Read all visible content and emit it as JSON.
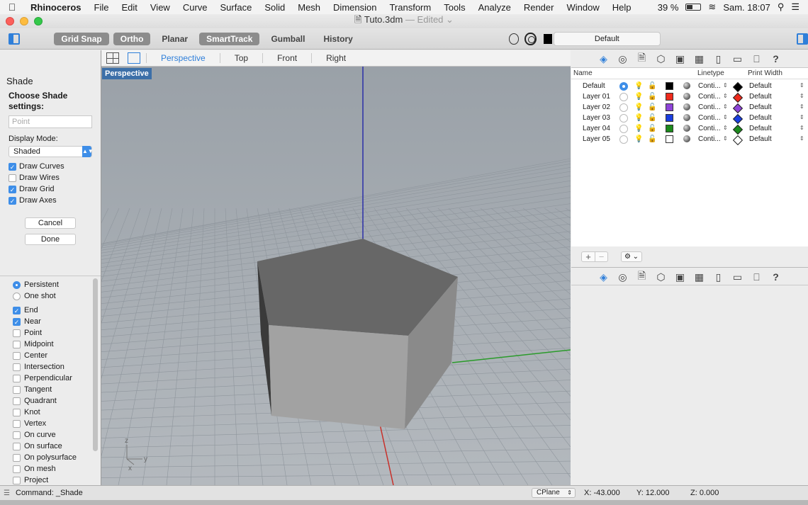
{
  "menubar": {
    "app_name": "Rhinoceros",
    "items": [
      "File",
      "Edit",
      "View",
      "Curve",
      "Surface",
      "Solid",
      "Mesh",
      "Dimension",
      "Transform",
      "Tools",
      "Analyze",
      "Render",
      "Window",
      "Help"
    ],
    "battery": "39 %",
    "clock": "Sam. 18:07"
  },
  "window": {
    "title": "Tuto.3dm",
    "edited": "— Edited"
  },
  "toolbar": {
    "grid_snap": "Grid Snap",
    "ortho": "Ortho",
    "planar": "Planar",
    "smarttrack": "SmartTrack",
    "gumball": "Gumball",
    "history": "History",
    "current_layer": "Default"
  },
  "shade_panel": {
    "title": "Shade",
    "heading": "Choose Shade settings:",
    "point_placeholder": "Point",
    "display_mode_label": "Display Mode:",
    "display_mode_value": "Shaded",
    "options": [
      {
        "label": "Draw Curves",
        "checked": true
      },
      {
        "label": "Draw Wires",
        "checked": false
      },
      {
        "label": "Draw Grid",
        "checked": true
      },
      {
        "label": "Draw Axes",
        "checked": true
      }
    ],
    "cancel": "Cancel",
    "done": "Done"
  },
  "osnap": {
    "modes": [
      {
        "label": "Persistent",
        "selected": true
      },
      {
        "label": "One shot",
        "selected": false
      }
    ],
    "snaps": [
      {
        "label": "End",
        "checked": true
      },
      {
        "label": "Near",
        "checked": true
      },
      {
        "label": "Point",
        "checked": false
      },
      {
        "label": "Midpoint",
        "checked": false
      },
      {
        "label": "Center",
        "checked": false
      },
      {
        "label": "Intersection",
        "checked": false
      },
      {
        "label": "Perpendicular",
        "checked": false
      },
      {
        "label": "Tangent",
        "checked": false
      },
      {
        "label": "Quadrant",
        "checked": false
      },
      {
        "label": "Knot",
        "checked": false
      },
      {
        "label": "Vertex",
        "checked": false
      },
      {
        "label": "On curve",
        "checked": false
      },
      {
        "label": "On surface",
        "checked": false
      },
      {
        "label": "On polysurface",
        "checked": false
      },
      {
        "label": "On mesh",
        "checked": false
      },
      {
        "label": "Project",
        "checked": false
      }
    ]
  },
  "viewport": {
    "tabs": [
      "Perspective",
      "Top",
      "Front",
      "Right"
    ],
    "active_tab": "Perspective",
    "label": "Perspective",
    "axis_labels": {
      "z": "z",
      "y": "y",
      "x": "x"
    }
  },
  "layers": {
    "headers": {
      "name": "Name",
      "linetype": "Linetype",
      "print_width": "Print Width"
    },
    "rows": [
      {
        "name": "Default",
        "current": true,
        "color": "#000000",
        "linetype": "Conti...",
        "print_width": "Default"
      },
      {
        "name": "Layer 01",
        "current": false,
        "color": "#ee2a1c",
        "linetype": "Conti...",
        "print_width": "Default"
      },
      {
        "name": "Layer 02",
        "current": false,
        "color": "#8e44d8",
        "linetype": "Conti...",
        "print_width": "Default"
      },
      {
        "name": "Layer 03",
        "current": false,
        "color": "#1a3ee0",
        "linetype": "Conti...",
        "print_width": "Default"
      },
      {
        "name": "Layer 04",
        "current": false,
        "color": "#1c8a1c",
        "linetype": "Conti...",
        "print_width": "Default"
      },
      {
        "name": "Layer 05",
        "current": false,
        "color": "#ffffff",
        "linetype": "Conti...",
        "print_width": "Default"
      }
    ]
  },
  "statusbar": {
    "command": "Command: _Shade",
    "cplane": "CPlane",
    "x": "X: -43.000",
    "y": "Y: 12.000",
    "z": "Z: 0.000"
  },
  "colors": {
    "accent": "#2f7fd9",
    "viewport_bg": "#a7adb3",
    "grid": "#8f969d",
    "solid_top": "#676767",
    "solid_front": "#a2a2a2",
    "solid_side": "#8a8a8a"
  }
}
